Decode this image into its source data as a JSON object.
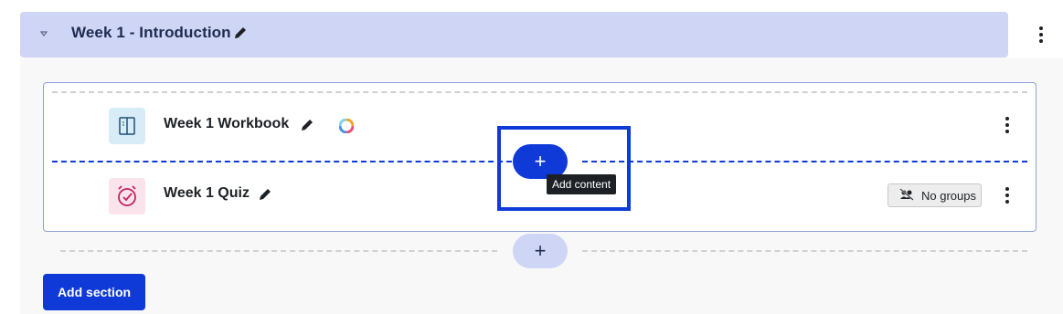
{
  "section": {
    "title": "Week 1 - Introduction"
  },
  "activities": [
    {
      "name": "Week 1 Workbook",
      "icon": "book-icon"
    },
    {
      "name": "Week 1 Quiz",
      "icon": "quiz-icon",
      "groups_label": "No groups"
    }
  ],
  "add_content": {
    "button_label": "+",
    "tooltip": "Add content"
  },
  "bottom_add": {
    "button_label": "+"
  },
  "add_section_label": "Add section",
  "colors": {
    "accent": "#0f3ad8",
    "header_bg": "#cfd5f5",
    "book_icon_bg": "#d8ecf7",
    "quiz_icon_bg": "#fbe3ec"
  }
}
